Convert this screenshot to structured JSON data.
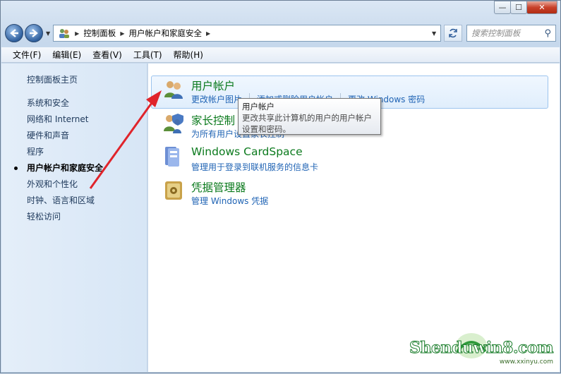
{
  "window": {
    "caption_buttons": [
      "—",
      "☐",
      "✕"
    ]
  },
  "navbar": {
    "breadcrumb": [
      "控制面板",
      "用户帐户和家庭安全"
    ],
    "search_placeholder": "搜索控制面板"
  },
  "menubar": {
    "items": [
      "文件(F)",
      "编辑(E)",
      "查看(V)",
      "工具(T)",
      "帮助(H)"
    ]
  },
  "sidebar": {
    "items": [
      {
        "label": "控制面板主页"
      },
      {
        "label": "系统和安全"
      },
      {
        "label": "网络和 Internet"
      },
      {
        "label": "硬件和声音"
      },
      {
        "label": "程序"
      },
      {
        "label": "用户帐户和家庭安全",
        "active": true
      },
      {
        "label": "外观和个性化"
      },
      {
        "label": "时钟、语言和区域"
      },
      {
        "label": "轻松访问"
      }
    ]
  },
  "categories": [
    {
      "title": "用户帐户",
      "icon": "users-icon",
      "links": [
        "更改帐户图片",
        "添加或删除用户帐户",
        "更改 Windows 密码"
      ]
    },
    {
      "title": "家长控制",
      "icon": "parental-controls-icon",
      "links": [
        "为所有用户设置家长控制"
      ]
    },
    {
      "title": "Windows CardSpace",
      "icon": "cardspace-icon",
      "links": [
        "管理用于登录到联机服务的信息卡"
      ]
    },
    {
      "title": "凭据管理器",
      "icon": "credential-manager-icon",
      "links": [
        "管理 Windows 凭据"
      ]
    }
  ],
  "tooltip": {
    "title": "用户帐户",
    "body_line1": "更改共享此计算机的用户的用户帐户",
    "body_line2": "设置和密码。"
  },
  "watermark": {
    "text": "Shenduwin8.com",
    "url": "www.xxinyu.com"
  },
  "colors": {
    "category_title": "#0b7a1d",
    "link": "#1f63b4",
    "annotation_arrow": "#e0242b"
  }
}
